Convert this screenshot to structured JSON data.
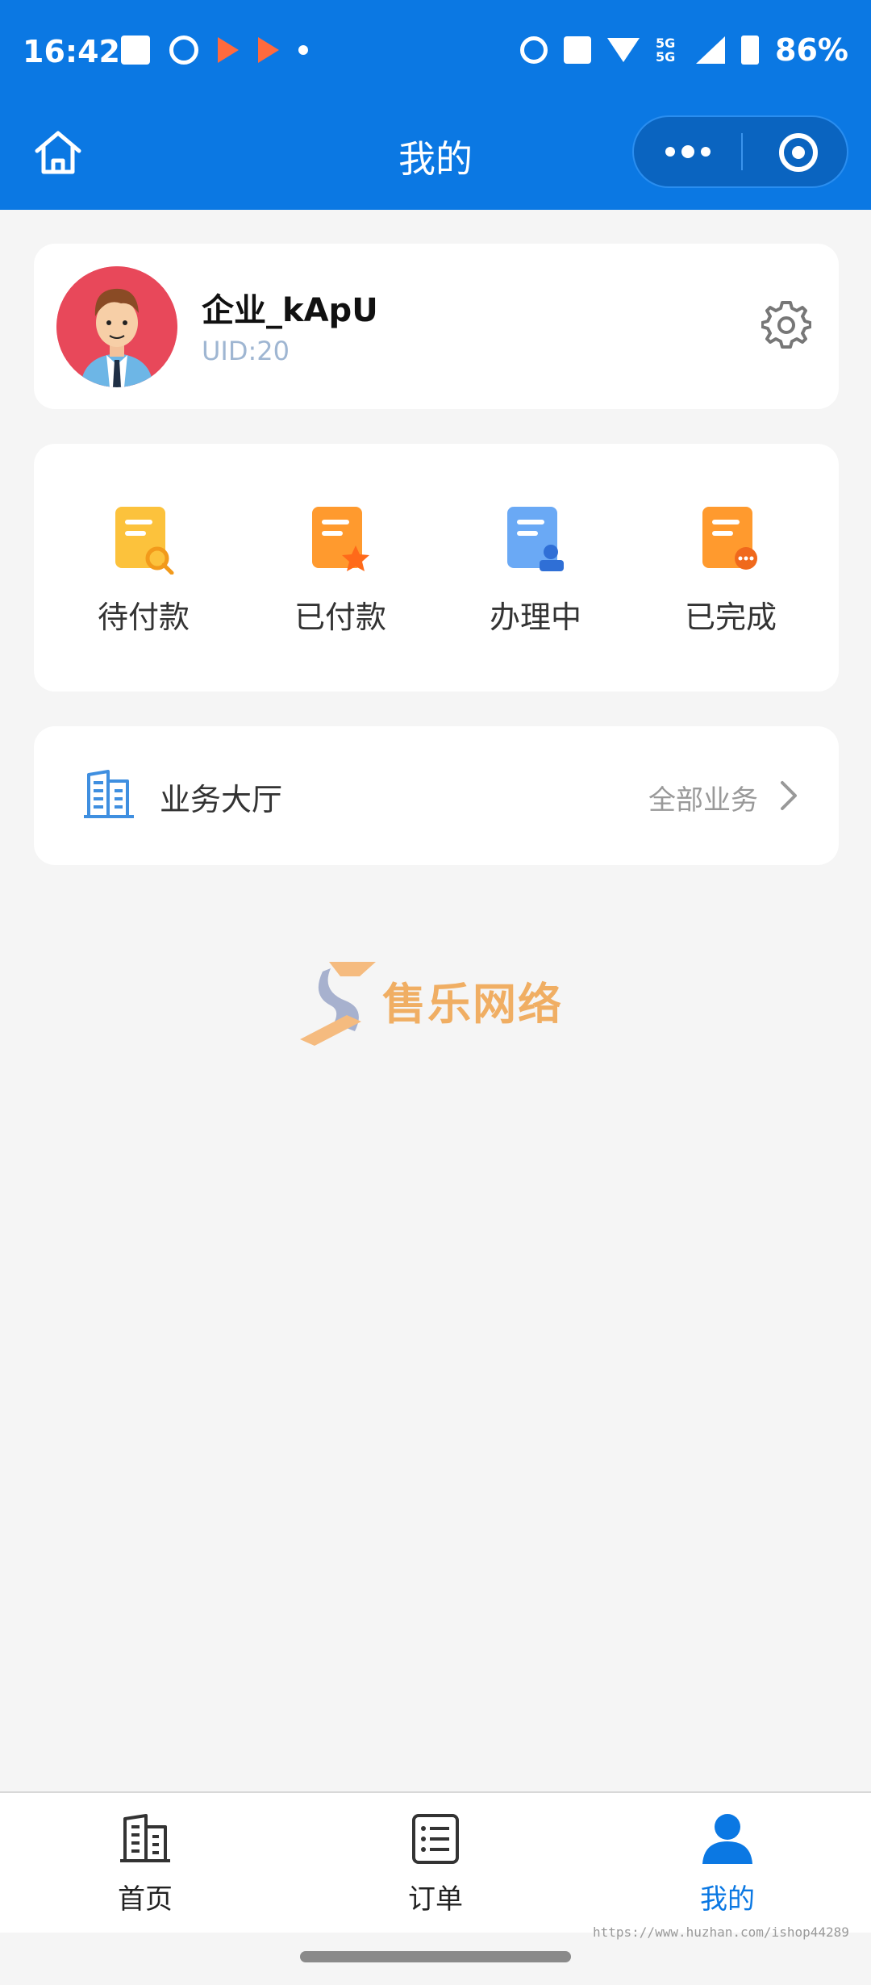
{
  "status_bar": {
    "time": "16:42",
    "battery": "86%",
    "network": "5G\n5G"
  },
  "nav": {
    "title": "我的"
  },
  "profile": {
    "name": "企业_kApU",
    "uid": "UID:20"
  },
  "orders": [
    {
      "label": "待付款",
      "icon": "pending-payment-icon",
      "color": "#fcc23c"
    },
    {
      "label": "已付款",
      "icon": "paid-icon",
      "color": "#ff9a2e"
    },
    {
      "label": "办理中",
      "icon": "processing-icon",
      "color": "#6aa9f5"
    },
    {
      "label": "已完成",
      "icon": "completed-icon",
      "color": "#ff9a2e"
    }
  ],
  "hall": {
    "label": "业务大厅",
    "link": "全部业务"
  },
  "watermark": {
    "text": "售乐网络"
  },
  "tabs": [
    {
      "label": "首页",
      "icon": "building-icon"
    },
    {
      "label": "订单",
      "icon": "list-icon"
    },
    {
      "label": "我的",
      "icon": "user-icon",
      "active": true
    }
  ],
  "footer_url": "https://www.huzhan.com/ishop44289",
  "colors": {
    "primary": "#0b78e3",
    "background": "#f5f5f5"
  }
}
